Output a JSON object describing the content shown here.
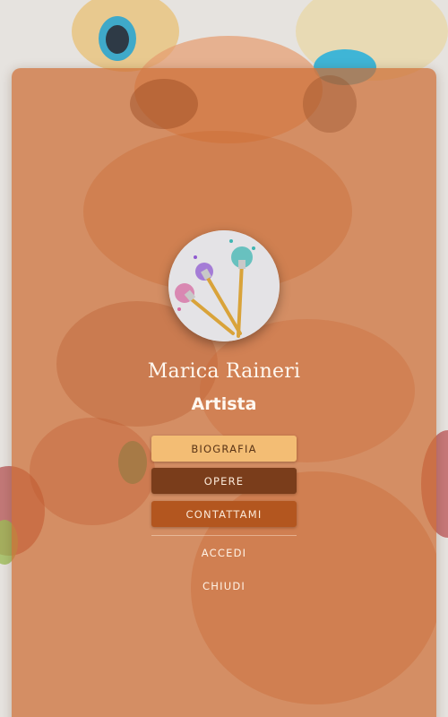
{
  "profile": {
    "name": "Marica Raineri",
    "role": "Artista",
    "avatar_icon": "paintbrushes-icon"
  },
  "menu": {
    "items": [
      {
        "label": "BIOGRAFIA",
        "active": true
      },
      {
        "label": "OPERE",
        "active": false
      },
      {
        "label": "CONTATTAMI",
        "active": false
      }
    ],
    "links": [
      {
        "label": "ACCEDI"
      },
      {
        "label": "CHIUDI"
      }
    ]
  },
  "colors": {
    "card_overlay": "#cd6e34",
    "button_active": "#f3bd74",
    "button_dark": "#7a3d1b",
    "button_medium": "#b3561f",
    "text_light": "#fff8f0"
  }
}
